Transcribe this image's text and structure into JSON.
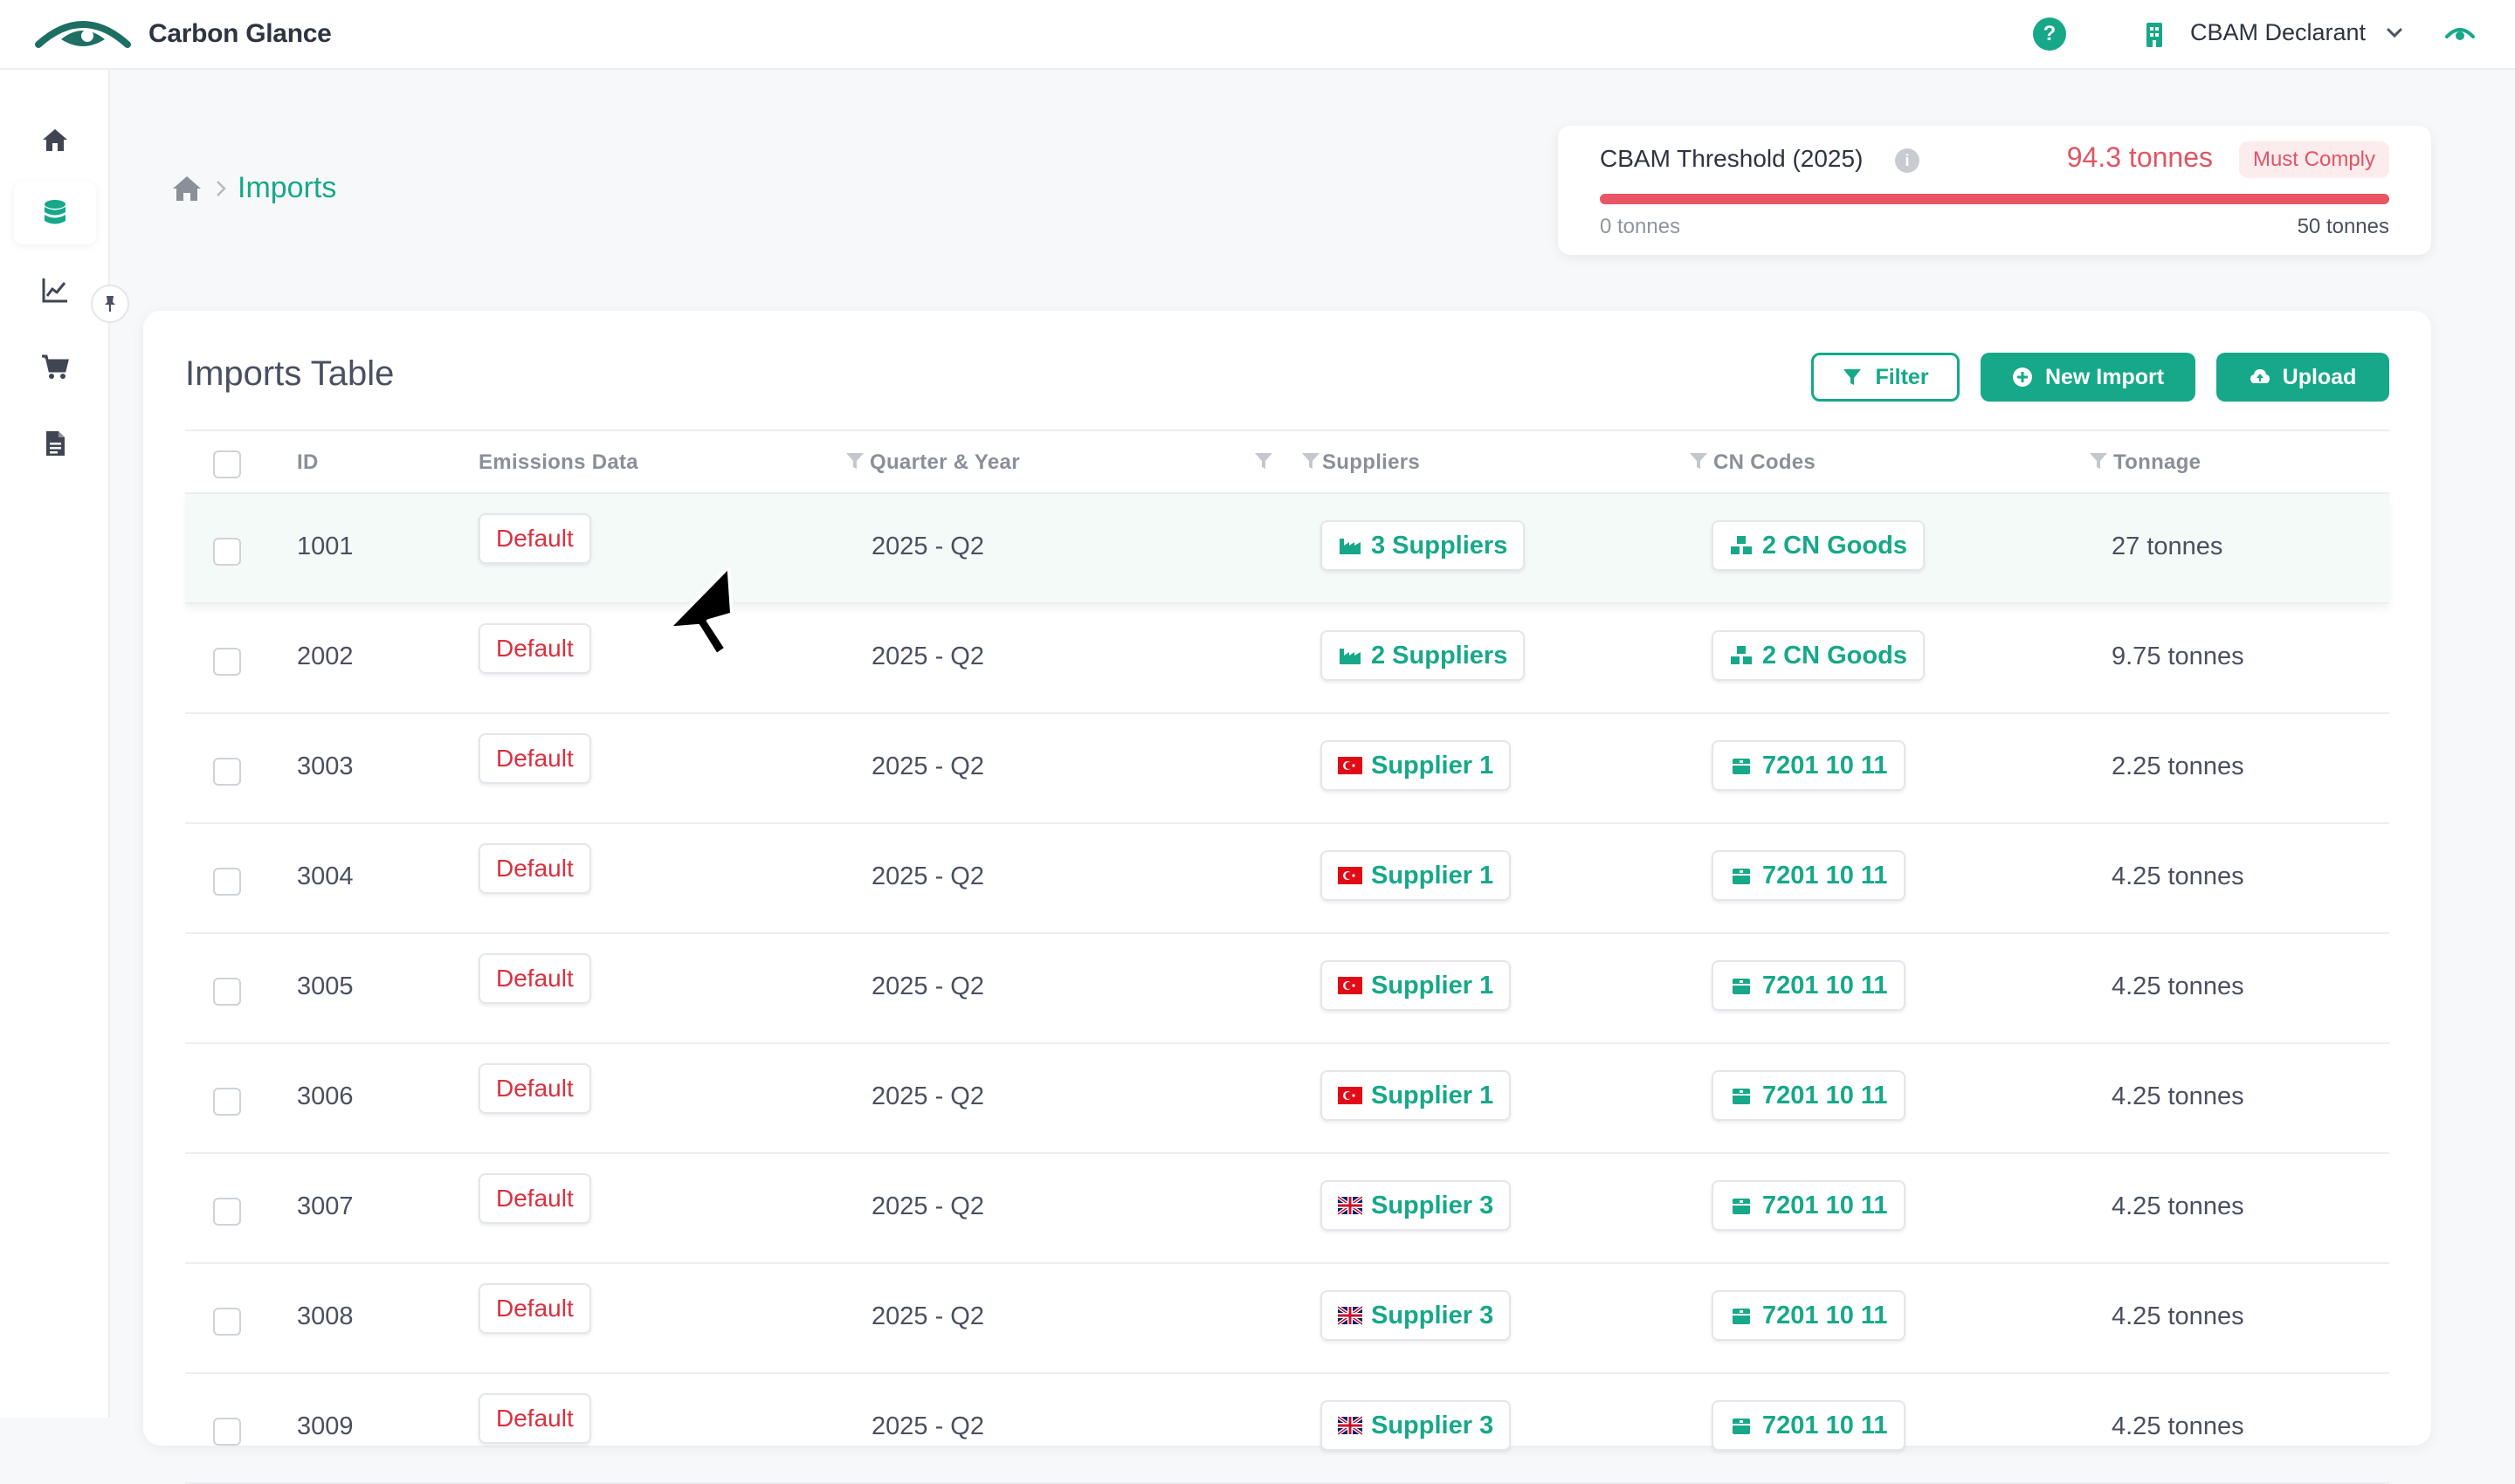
{
  "app": {
    "brand_name": "Carbon Glance",
    "help_label": "?",
    "org_name": "CBAM Declarant"
  },
  "icons": {
    "logo": "carbon-glance-eye-logo",
    "help": "question-circle-icon",
    "org": "building-icon",
    "chevron": "chevron-down-icon",
    "eye": "eye-icon",
    "sidebar": [
      "home-icon",
      "database-icon",
      "chart-line-icon",
      "cart-icon",
      "document-icon"
    ],
    "pin": "pin-icon"
  },
  "breadcrumb": {
    "current": "Imports"
  },
  "threshold": {
    "title": "CBAM Threshold (2025)",
    "info": "i",
    "value": "94.3 tonnes",
    "badge": "Must Comply",
    "min_label": "0 tonnes",
    "max_label": "50 tonnes",
    "progress_fraction": 1.0
  },
  "table": {
    "title": "Imports Table",
    "buttons": {
      "filter": "Filter",
      "new_import": "New Import",
      "upload": "Upload"
    },
    "columns": [
      "ID",
      "Emissions Data",
      "Quarter & Year",
      "Suppliers",
      "CN Codes",
      "Tonnage"
    ],
    "rows": [
      {
        "id": "1001",
        "emissions": "Default",
        "quarter": "2025 - Q2",
        "suppliers": "3 Suppliers",
        "supplier_icon": "factory",
        "cn": "2 CN Goods",
        "cn_icon": "boxes",
        "tonnage": "27 tonnes"
      },
      {
        "id": "2002",
        "emissions": "Default",
        "quarter": "2025 - Q2",
        "suppliers": "2 Suppliers",
        "supplier_icon": "factory",
        "cn": "2 CN Goods",
        "cn_icon": "boxes",
        "tonnage": "9.75 tonnes"
      },
      {
        "id": "3003",
        "emissions": "Default",
        "quarter": "2025 - Q2",
        "suppliers": "Supplier 1",
        "supplier_icon": "flag-turkey",
        "cn": "7201 10 11",
        "cn_icon": "box",
        "tonnage": "2.25 tonnes"
      },
      {
        "id": "3004",
        "emissions": "Default",
        "quarter": "2025 - Q2",
        "suppliers": "Supplier 1",
        "supplier_icon": "flag-turkey",
        "cn": "7201 10 11",
        "cn_icon": "box",
        "tonnage": "4.25 tonnes"
      },
      {
        "id": "3005",
        "emissions": "Default",
        "quarter": "2025 - Q2",
        "suppliers": "Supplier 1",
        "supplier_icon": "flag-turkey",
        "cn": "7201 10 11",
        "cn_icon": "box",
        "tonnage": "4.25 tonnes"
      },
      {
        "id": "3006",
        "emissions": "Default",
        "quarter": "2025 - Q2",
        "suppliers": "Supplier 1",
        "supplier_icon": "flag-turkey",
        "cn": "7201 10 11",
        "cn_icon": "box",
        "tonnage": "4.25 tonnes"
      },
      {
        "id": "3007",
        "emissions": "Default",
        "quarter": "2025 - Q2",
        "suppliers": "Supplier 3",
        "supplier_icon": "flag-uk",
        "cn": "7201 10 11",
        "cn_icon": "box",
        "tonnage": "4.25 tonnes"
      },
      {
        "id": "3008",
        "emissions": "Default",
        "quarter": "2025 - Q2",
        "suppliers": "Supplier 3",
        "supplier_icon": "flag-uk",
        "cn": "7201 10 11",
        "cn_icon": "box",
        "tonnage": "4.25 tonnes"
      },
      {
        "id": "3009",
        "emissions": "Default",
        "quarter": "2025 - Q2",
        "suppliers": "Supplier 3",
        "supplier_icon": "flag-uk",
        "cn": "7201 10 11",
        "cn_icon": "box",
        "tonnage": "4.25 tonnes"
      }
    ]
  },
  "colors": {
    "accent": "#16a889",
    "danger": "#e05563",
    "text": "#4a5060"
  }
}
